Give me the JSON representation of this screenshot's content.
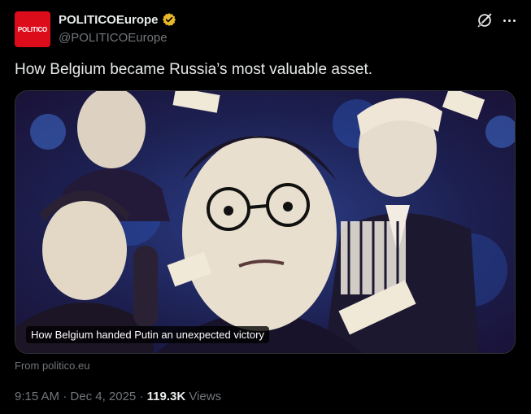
{
  "author": {
    "avatar_text": "POLITICO",
    "display_name": "POLITICOEurope",
    "handle": "@POLITICOEurope",
    "verified_color": "#e8b829",
    "avatar_color": "#dc0c1b"
  },
  "actions": {
    "grok_icon": "grok-icon",
    "more_icon": "more-icon"
  },
  "tweet": {
    "text": "How Belgium became Russia’s most valuable asset."
  },
  "card": {
    "caption": "How Belgium handed Putin an unexpected victory",
    "source": "From politico.eu"
  },
  "meta": {
    "time": "9:15 AM",
    "separator1": " · ",
    "date": "Dec 4, 2025",
    "separator2": " · ",
    "views_count": "119.3K",
    "views_label": " Views"
  }
}
